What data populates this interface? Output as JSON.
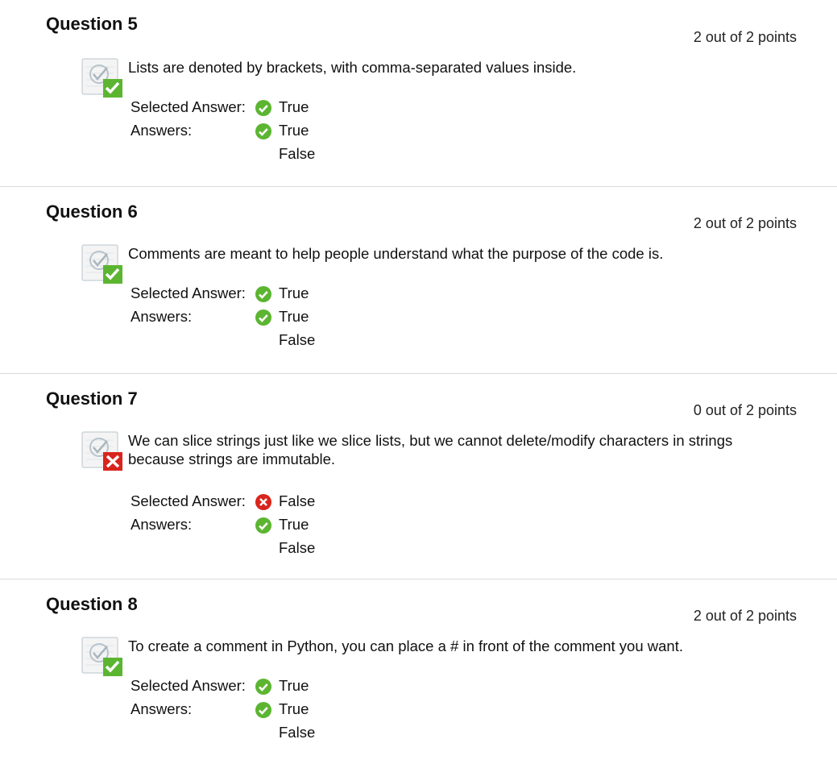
{
  "labels": {
    "selected": "Selected Answer:",
    "answers": "Answers:"
  },
  "colors": {
    "correct": "#5cb531",
    "incorrect": "#d9251d",
    "divider": "#d9d9d9"
  },
  "questions": [
    {
      "title": "Question 5",
      "points": "2 out of 2 points",
      "text": "Lists are denoted by brackets, with comma-separated values inside.",
      "status_icon": "correct-check-icon",
      "selected": "True",
      "answer_correct": "True",
      "answer_other": "False"
    },
    {
      "title": "Question 6",
      "points": "2 out of 2 points",
      "text": "Comments are meant to help people understand what the purpose of the code is.",
      "status_icon": "correct-check-icon",
      "selected": "True",
      "answer_correct": "True",
      "answer_other": "False"
    },
    {
      "title": "Question 7",
      "points": "0 out of 2 points",
      "text": "We can slice strings just like we slice lists, but we cannot delete/modify characters in strings because strings are immutable.",
      "status_icon": "incorrect-x-icon",
      "selected": "False",
      "answer_correct": "True",
      "answer_other": "False"
    },
    {
      "title": "Question 8",
      "points": "2 out of 2 points",
      "text": "To create a comment in Python, you can place a # in front of the comment you want.",
      "status_icon": "correct-check-icon",
      "selected": "True",
      "answer_correct": "True",
      "answer_other": "False"
    }
  ]
}
